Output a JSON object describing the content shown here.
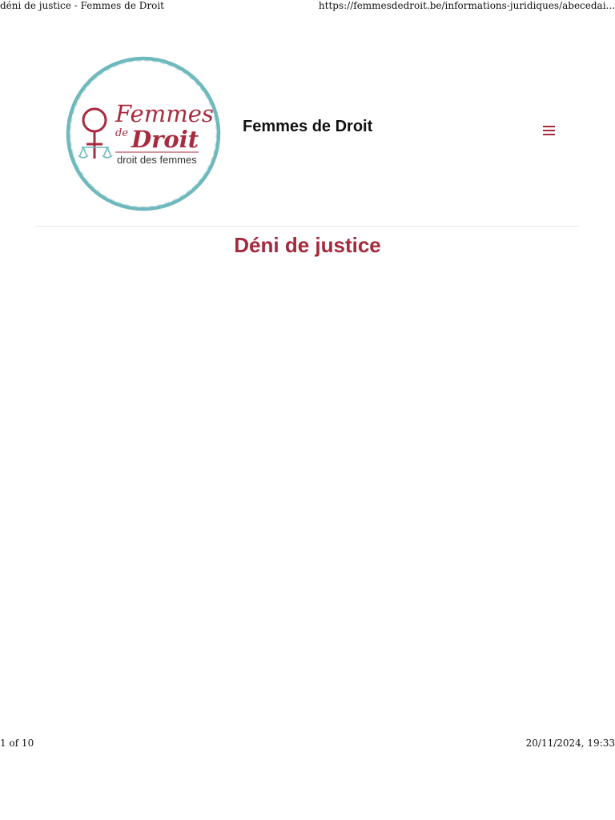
{
  "print_header": {
    "title": "déni de justice - Femmes de Droit",
    "url": "https://femmesdedroit.be/informations-juridiques/abecedai..."
  },
  "site": {
    "name": "Femmes de Droit",
    "logo": {
      "wordmark_line1": "Femmes",
      "wordmark_line2": "de",
      "wordmark_line3": "Droit",
      "tagline": "droit des femmes",
      "ring_color": "#6fb9bd",
      "text_color": "#a82b3f"
    },
    "menu_icon": "hamburger-menu-icon"
  },
  "page": {
    "title": "Déni de justice"
  },
  "print_footer": {
    "page": "1 of 10",
    "timestamp": "20/11/2024, 19:33"
  },
  "colors": {
    "accent": "#a52a3c",
    "menu": "#a52a3c",
    "rule": "#e6e6e6"
  }
}
